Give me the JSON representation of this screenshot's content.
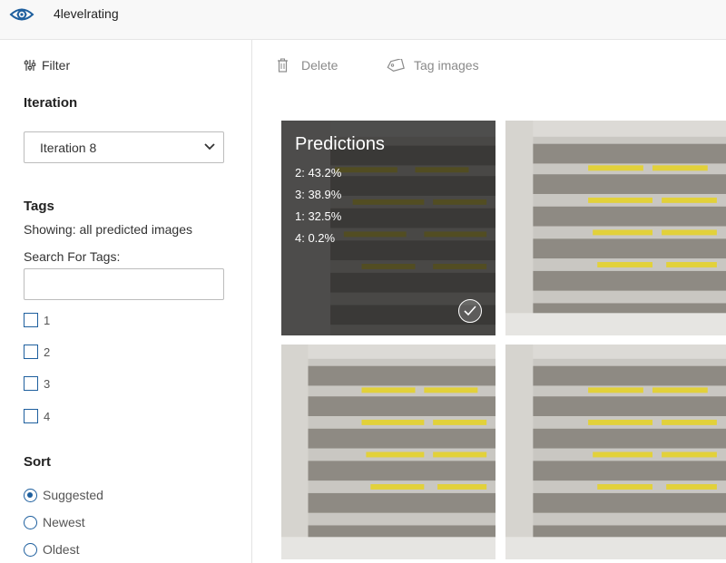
{
  "header": {
    "project_name": "4levelrating",
    "logo_icon": "eye-icon"
  },
  "sidebar": {
    "filter_label": "Filter",
    "iteration": {
      "heading": "Iteration",
      "selected": "Iteration 8"
    },
    "tags": {
      "heading": "Tags",
      "showing": "Showing: all predicted images",
      "search_label": "Search For Tags:",
      "search_value": "",
      "items": [
        {
          "label": "1",
          "checked": false
        },
        {
          "label": "2",
          "checked": false
        },
        {
          "label": "3",
          "checked": false
        },
        {
          "label": "4",
          "checked": false
        }
      ]
    },
    "sort": {
      "heading": "Sort",
      "options": [
        {
          "label": "Suggested",
          "selected": true
        },
        {
          "label": "Newest",
          "selected": false
        },
        {
          "label": "Oldest",
          "selected": false
        }
      ]
    }
  },
  "toolbar": {
    "delete_label": "Delete",
    "tag_images_label": "Tag images"
  },
  "grid": {
    "images": [
      {
        "hovered": true,
        "predictions_title": "Predictions",
        "predictions": [
          "2: 43.2%",
          "3: 38.9%",
          "1: 32.5%",
          "4: 0.2%"
        ]
      },
      {
        "hovered": false
      },
      {
        "hovered": false
      },
      {
        "hovered": false
      }
    ]
  },
  "colors": {
    "accent": "#1e5f9e",
    "toolbar_text": "#8a8a8a",
    "overlay": "#191919"
  }
}
